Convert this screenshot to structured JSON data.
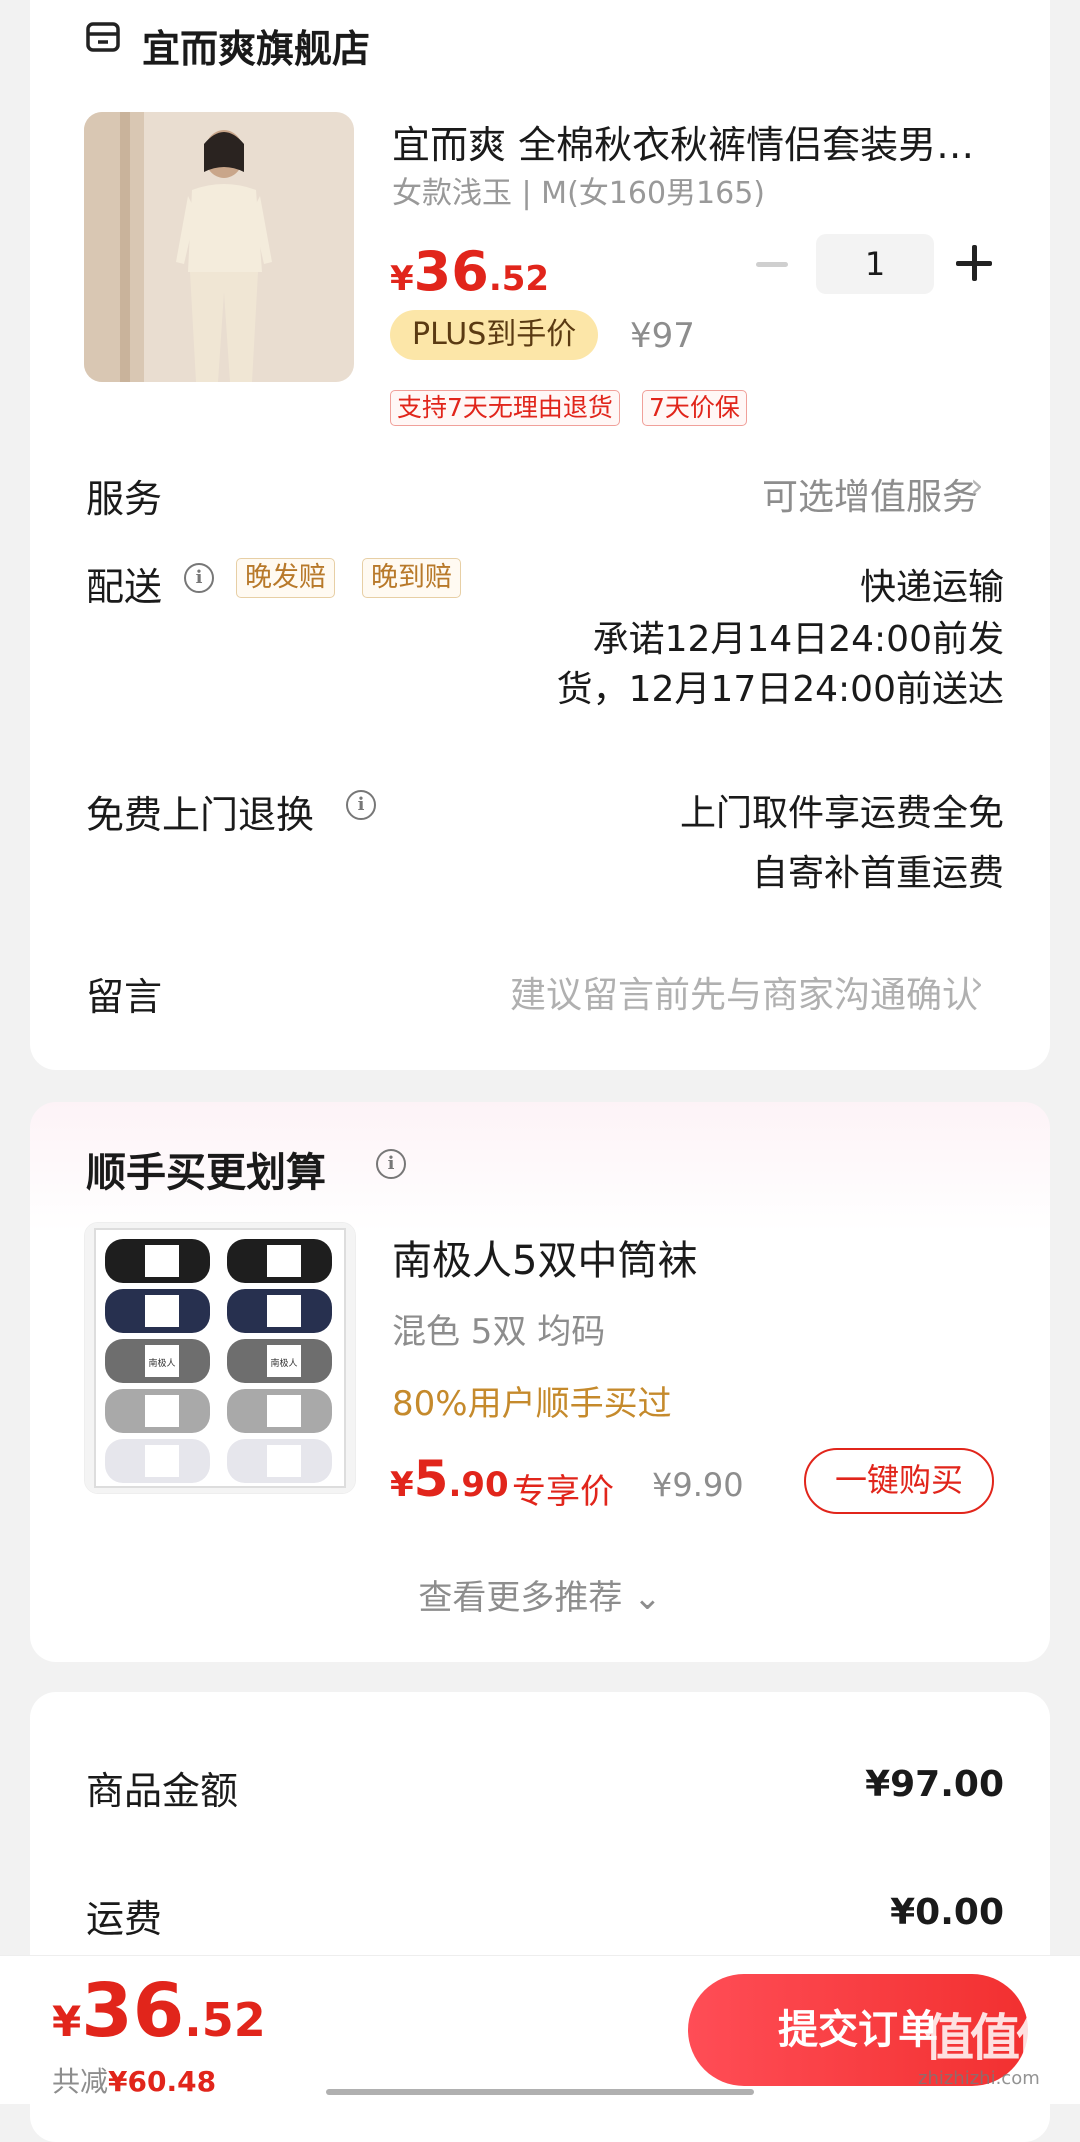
{
  "store": {
    "name": "宜而爽旗舰店",
    "icon": "store-icon"
  },
  "product": {
    "title": "宜而爽 全棉秋衣秋裤情侣套装男…",
    "spec": "女款浅玉 | M(女160男165)",
    "price_symbol": "¥",
    "price_int": "36",
    "price_dec": ".52",
    "quantity": "1",
    "plus_badge": "PLUS到手价",
    "original_price": "¥97",
    "tags": [
      "支持7天无理由退货",
      "7天价保"
    ]
  },
  "service": {
    "label": "服务",
    "value": "可选增值服务",
    "chevron": "›"
  },
  "delivery": {
    "label": "配送",
    "tags": [
      "晚发赔",
      "晚到赔"
    ],
    "method": "快递运输",
    "promise_line1": "承诺12月14日24:00前发",
    "promise_line2": "货，12月17日24:00前送达"
  },
  "returns": {
    "label": "免费上门退换",
    "line1": "上门取件享运费全免",
    "line2": "自寄补首重运费"
  },
  "message": {
    "label": "留言",
    "placeholder": "建议留言前先与商家沟通确认",
    "chevron": "›"
  },
  "addon": {
    "section_title": "顺手买更划算",
    "title": "南极人5双中筒袜",
    "spec": "混色 5双    均码",
    "buyers": "80%用户顺手买过",
    "price_symbol": "¥",
    "price_int": "5",
    "price_dec": ".90",
    "exclusive_label": "专享价",
    "original_price": "¥9.90",
    "buy_button": "一键购买",
    "more_link": "查看更多推荐",
    "more_chevron": "⌄",
    "brand_on_box": "南极人"
  },
  "summary": {
    "goods_label": "商品金额",
    "goods_value": "¥97.00",
    "shipping_label": "运费",
    "shipping_value": "¥0.00"
  },
  "footer": {
    "total_symbol": "¥",
    "total_int": "36",
    "total_dec": ".52",
    "saved_label": "共减",
    "saved_value": "¥60.48",
    "submit_button": "提交订单"
  },
  "watermark": {
    "text": "值值值",
    "sub": "zhizhizhi.com"
  },
  "colors": {
    "accent": "#e1251b",
    "plus_badge_bg": "#fce6a8",
    "gold_tag": "#b8792a"
  }
}
